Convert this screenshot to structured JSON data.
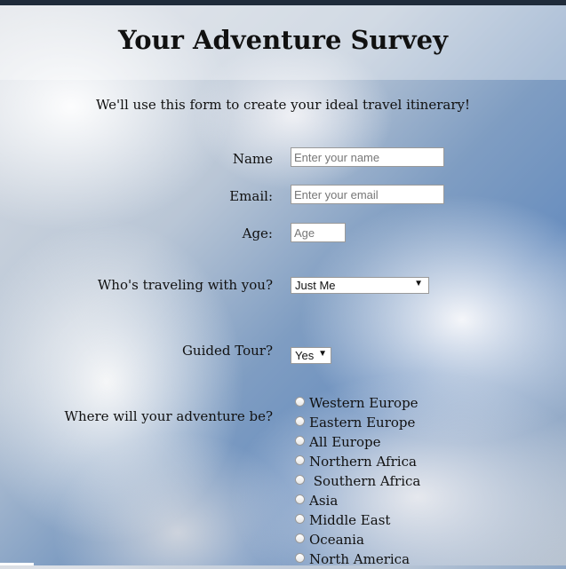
{
  "header": {
    "title": "Your Adventure Survey"
  },
  "intro": "We'll use this form to create your ideal travel itinerary!",
  "form": {
    "name": {
      "label": "Name",
      "placeholder": "Enter your name"
    },
    "email": {
      "label": "Email:",
      "placeholder": "Enter your email"
    },
    "age": {
      "label": "Age:",
      "placeholder": "Age"
    },
    "companions": {
      "label": "Who's traveling with you?",
      "selected": "Just Me"
    },
    "guided": {
      "label": "Guided Tour?",
      "selected": "Yes"
    },
    "destination": {
      "label": "Where will your adventure be?",
      "options": [
        "Western Europe",
        "Eastern Europe",
        "All Europe",
        "Northern Africa",
        " Southern Africa",
        "Asia",
        "Middle East",
        "Oceania",
        "North America"
      ]
    }
  },
  "icons": {
    "dropdown_arrow": "▼"
  }
}
